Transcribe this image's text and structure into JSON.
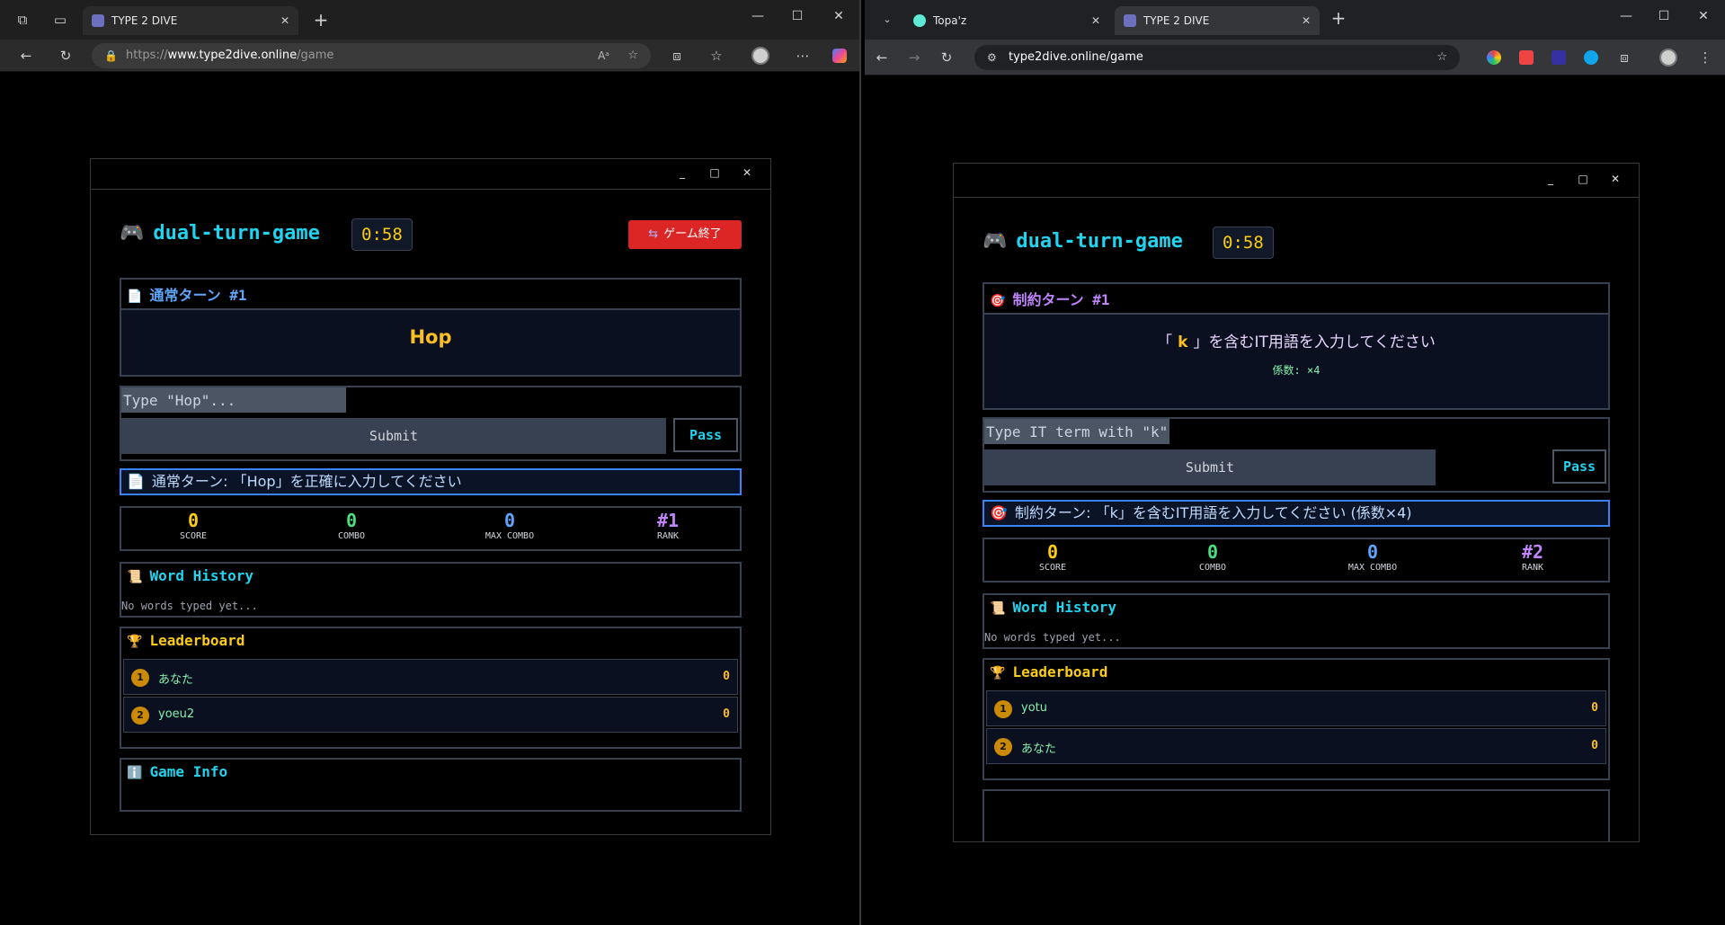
{
  "left": {
    "tab_title": "TYPE 2 DIVE",
    "url": {
      "scheme": "https://",
      "host": "www.type2dive.online",
      "path": "/game"
    },
    "game": {
      "title": "dual-turn-game",
      "timer": "0:58",
      "end_button": "ゲーム終了",
      "turn_title": "通常ターン #1",
      "target_word": "Hop",
      "input_placeholder": "Type \"Hop\"...",
      "submit_label": "Submit",
      "pass_label": "Pass",
      "status_text": "通常ターン: 「Hop」を正確に入力してください",
      "stats": [
        {
          "value": "0",
          "label": "SCORE"
        },
        {
          "value": "0",
          "label": "COMBO"
        },
        {
          "value": "0",
          "label": "MAX COMBO"
        },
        {
          "value": "#1",
          "label": "RANK"
        }
      ],
      "history_title": "Word History",
      "history_empty": "No words typed yet...",
      "leaderboard_title": "Leaderboard",
      "leaderboard": [
        {
          "rank": "1",
          "name": "あなた",
          "score": "0"
        },
        {
          "rank": "2",
          "name": "yoeu2",
          "score": "0"
        }
      ],
      "info_title": "Game Info"
    }
  },
  "right": {
    "tabs": [
      "Topa'z",
      "TYPE 2 DIVE"
    ],
    "url": "type2dive.online/game",
    "game": {
      "title": "dual-turn-game",
      "timer": "0:58",
      "turn_title": "制約ターン #1",
      "prompt_open": "「",
      "prompt_letter": "k",
      "prompt_rest": "」を含むIT用語を入力してください",
      "coef": "係数: ×4",
      "input_placeholder": "Type IT term with \"k\"...",
      "submit_label": "Submit",
      "pass_label": "Pass",
      "status_text": "制約ターン: 「k」を含むIT用語を入力してください (係数×4)",
      "stats": [
        {
          "value": "0",
          "label": "SCORE"
        },
        {
          "value": "0",
          "label": "COMBO"
        },
        {
          "value": "0",
          "label": "MAX COMBO"
        },
        {
          "value": "#2",
          "label": "RANK"
        }
      ],
      "history_title": "Word History",
      "history_empty": "No words typed yet...",
      "leaderboard_title": "Leaderboard",
      "leaderboard": [
        {
          "rank": "1",
          "name": "yotu",
          "score": "0"
        },
        {
          "rank": "2",
          "name": "あなた",
          "score": "0"
        }
      ]
    }
  },
  "colors": {
    "title": "#22d3ee",
    "timer": "#facc15",
    "score": "#facc15",
    "combo": "#4ade80",
    "max_combo": "#60a5fa",
    "rank": "#c084fc",
    "normal_turn": "#60a5fa",
    "constraint_turn": "#c084fc",
    "end_button": "#dc2626"
  }
}
